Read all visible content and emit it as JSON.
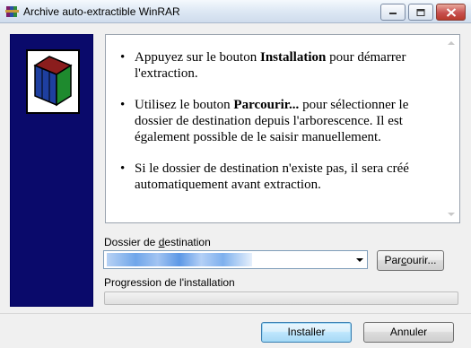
{
  "window": {
    "title": "Archive auto-extractible WinRAR",
    "icon": "winrar-icon",
    "controls": [
      "minimize-icon",
      "maximize-icon",
      "close-icon"
    ]
  },
  "banner": {
    "icon": "winrar-books-logo-icon",
    "color": "#0a0a6b"
  },
  "info": {
    "items": [
      {
        "pre": "Appuyez sur le bouton ",
        "bold": "Installation",
        "post": " pour démarrer l'extraction."
      },
      {
        "pre": "Utilisez le bouton ",
        "bold": "Parcourir...",
        "post": " pour sélectionner le dossier de destination depuis l'arborescence. Il est également possible de le saisir manuellement."
      },
      {
        "pre": "Si le dossier de destination n'existe pas, il sera créé automatiquement avant extraction.",
        "bold": "",
        "post": ""
      }
    ]
  },
  "destination": {
    "label_pre": "Dossier de ",
    "label_underlined": "d",
    "label_post": "estination",
    "value": "",
    "browse_pre": "Par",
    "browse_underlined": "c",
    "browse_post": "ourir..."
  },
  "progress": {
    "label": "Progression de l'installation",
    "value": 0,
    "color": "#37b64a"
  },
  "buttons": {
    "install": "Installer",
    "cancel": "Annuler"
  }
}
